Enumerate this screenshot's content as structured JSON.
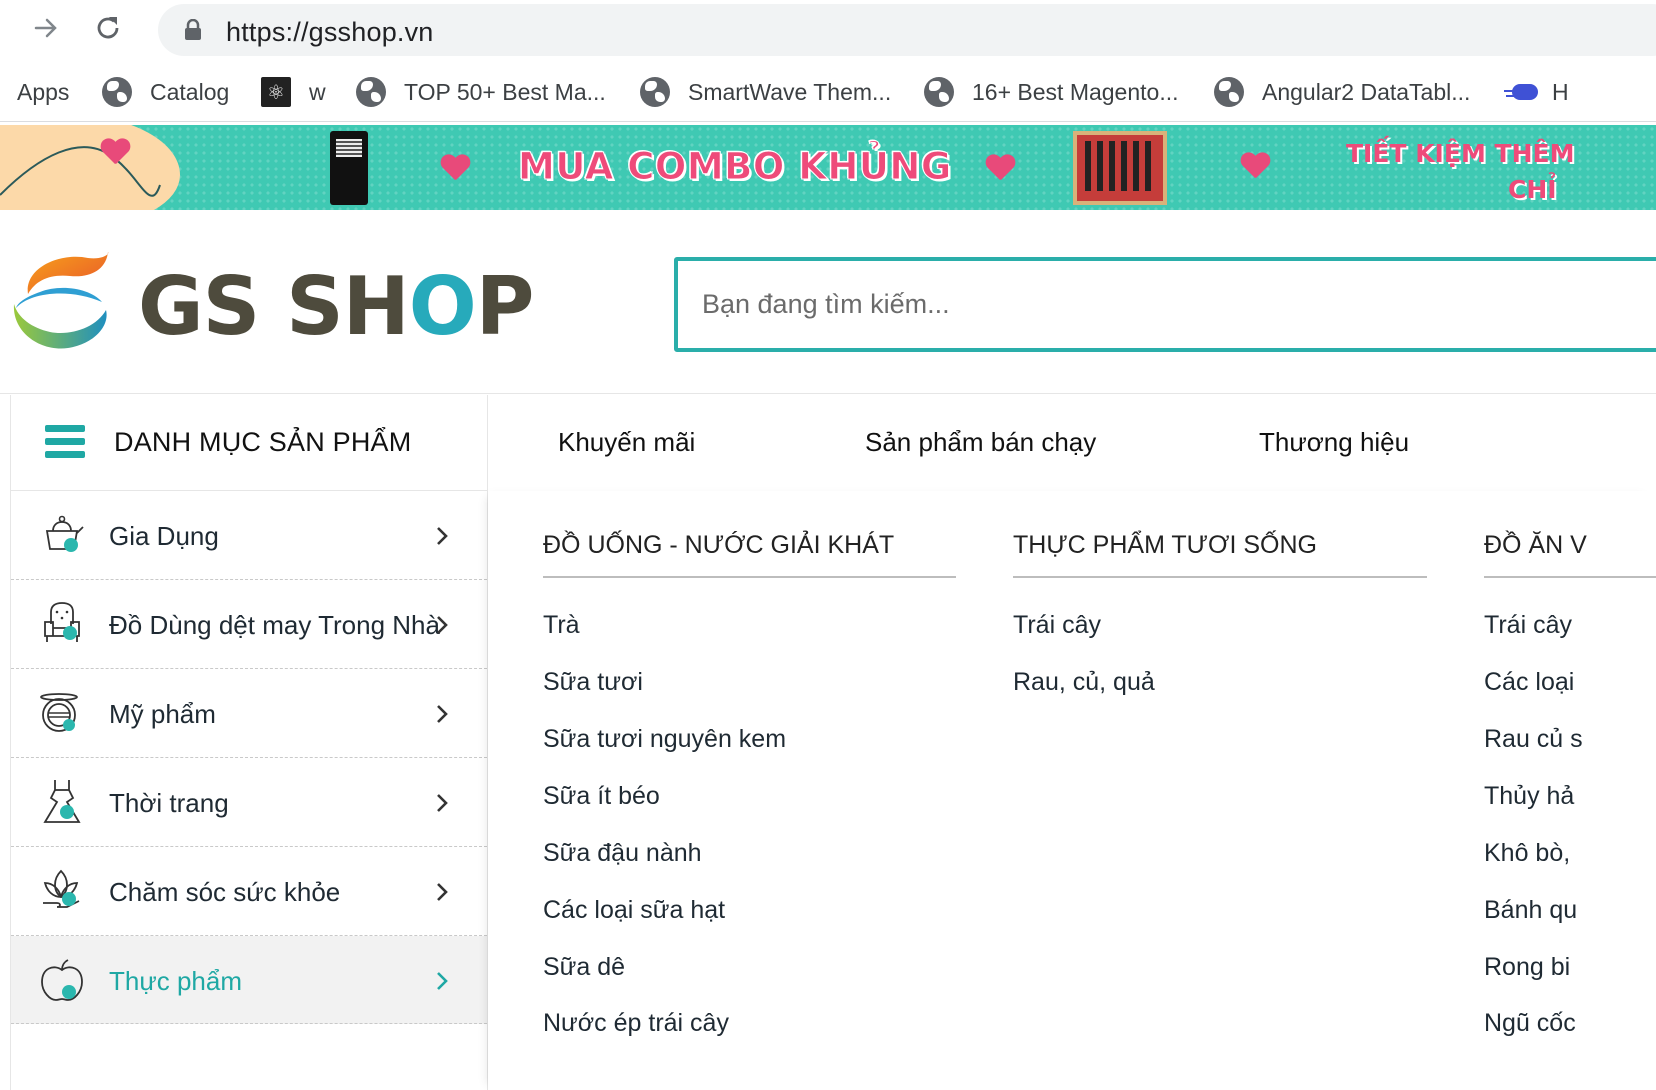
{
  "browser": {
    "url": "https://gsshop.vn",
    "bookmarks": [
      {
        "label": "Apps",
        "icon": "apps-grid-icon"
      },
      {
        "label": "Catalog",
        "icon": "globe-icon"
      },
      {
        "label": "w",
        "icon": "react-icon"
      },
      {
        "label": "TOP 50+ Best Ma...",
        "icon": "globe-icon"
      },
      {
        "label": "SmartWave Them...",
        "icon": "globe-icon"
      },
      {
        "label": "16+ Best Magento...",
        "icon": "globe-icon"
      },
      {
        "label": "Angular2 DataTabl...",
        "icon": "globe-icon"
      },
      {
        "label": "H",
        "icon": "cloud-icon"
      }
    ]
  },
  "banner": {
    "title": "MUA COMBO KHỦNG",
    "subtitle_line1": "TIẾT KIỆM THÊM",
    "subtitle_line2": "CHỈ"
  },
  "header": {
    "logo_text_before": "GS SH",
    "logo_text_o": "O",
    "logo_text_after": "P",
    "search_placeholder": "Bạn đang tìm kiếm..."
  },
  "nav": {
    "category_title": "DANH MỤC SẢN PHẨM",
    "links": [
      "Khuyến mãi",
      "Sản phẩm bán chạy",
      "Thương hiệu"
    ]
  },
  "categories": [
    {
      "label": "Gia Dụng",
      "icon": "kettle-icon",
      "active": false
    },
    {
      "label": "Đồ Dùng dệt may Trong Nhà",
      "icon": "armchair-icon",
      "active": false
    },
    {
      "label": "Mỹ phẩm",
      "icon": "compact-powder-icon",
      "active": false
    },
    {
      "label": "Thời trang",
      "icon": "dress-icon",
      "active": false
    },
    {
      "label": "Chăm sóc sức khỏe",
      "icon": "leaf-hand-icon",
      "active": false
    },
    {
      "label": "Thực phẩm",
      "icon": "apple-icon",
      "active": true
    }
  ],
  "mega_menu": {
    "columns": [
      {
        "title": "ĐỒ UỐNG - NƯỚC GIẢI KHÁT",
        "links": [
          "Trà",
          "Sữa tươi",
          "Sữa tươi nguyên kem",
          "Sữa ít béo",
          "Sữa đậu nành",
          "Các loại sữa hạt",
          "Sữa dê",
          "Nước ép trái cây"
        ]
      },
      {
        "title": "THỰC PHẨM TƯƠI SỐNG",
        "links": [
          "Trái cây",
          "Rau, củ, quả"
        ]
      },
      {
        "title": "ĐỒ ĂN V",
        "links": [
          "Trái cây",
          "Các loại",
          "Rau củ s",
          "Thủy hả",
          "Khô bò,",
          "Bánh qu",
          "Rong bi",
          "Ngũ cốc"
        ]
      }
    ]
  },
  "colors": {
    "accent": "#1fa8a4",
    "search_border": "#2aaeaa",
    "banner_bg": "#3fc9b3",
    "banner_text": "#ee4b7a"
  }
}
